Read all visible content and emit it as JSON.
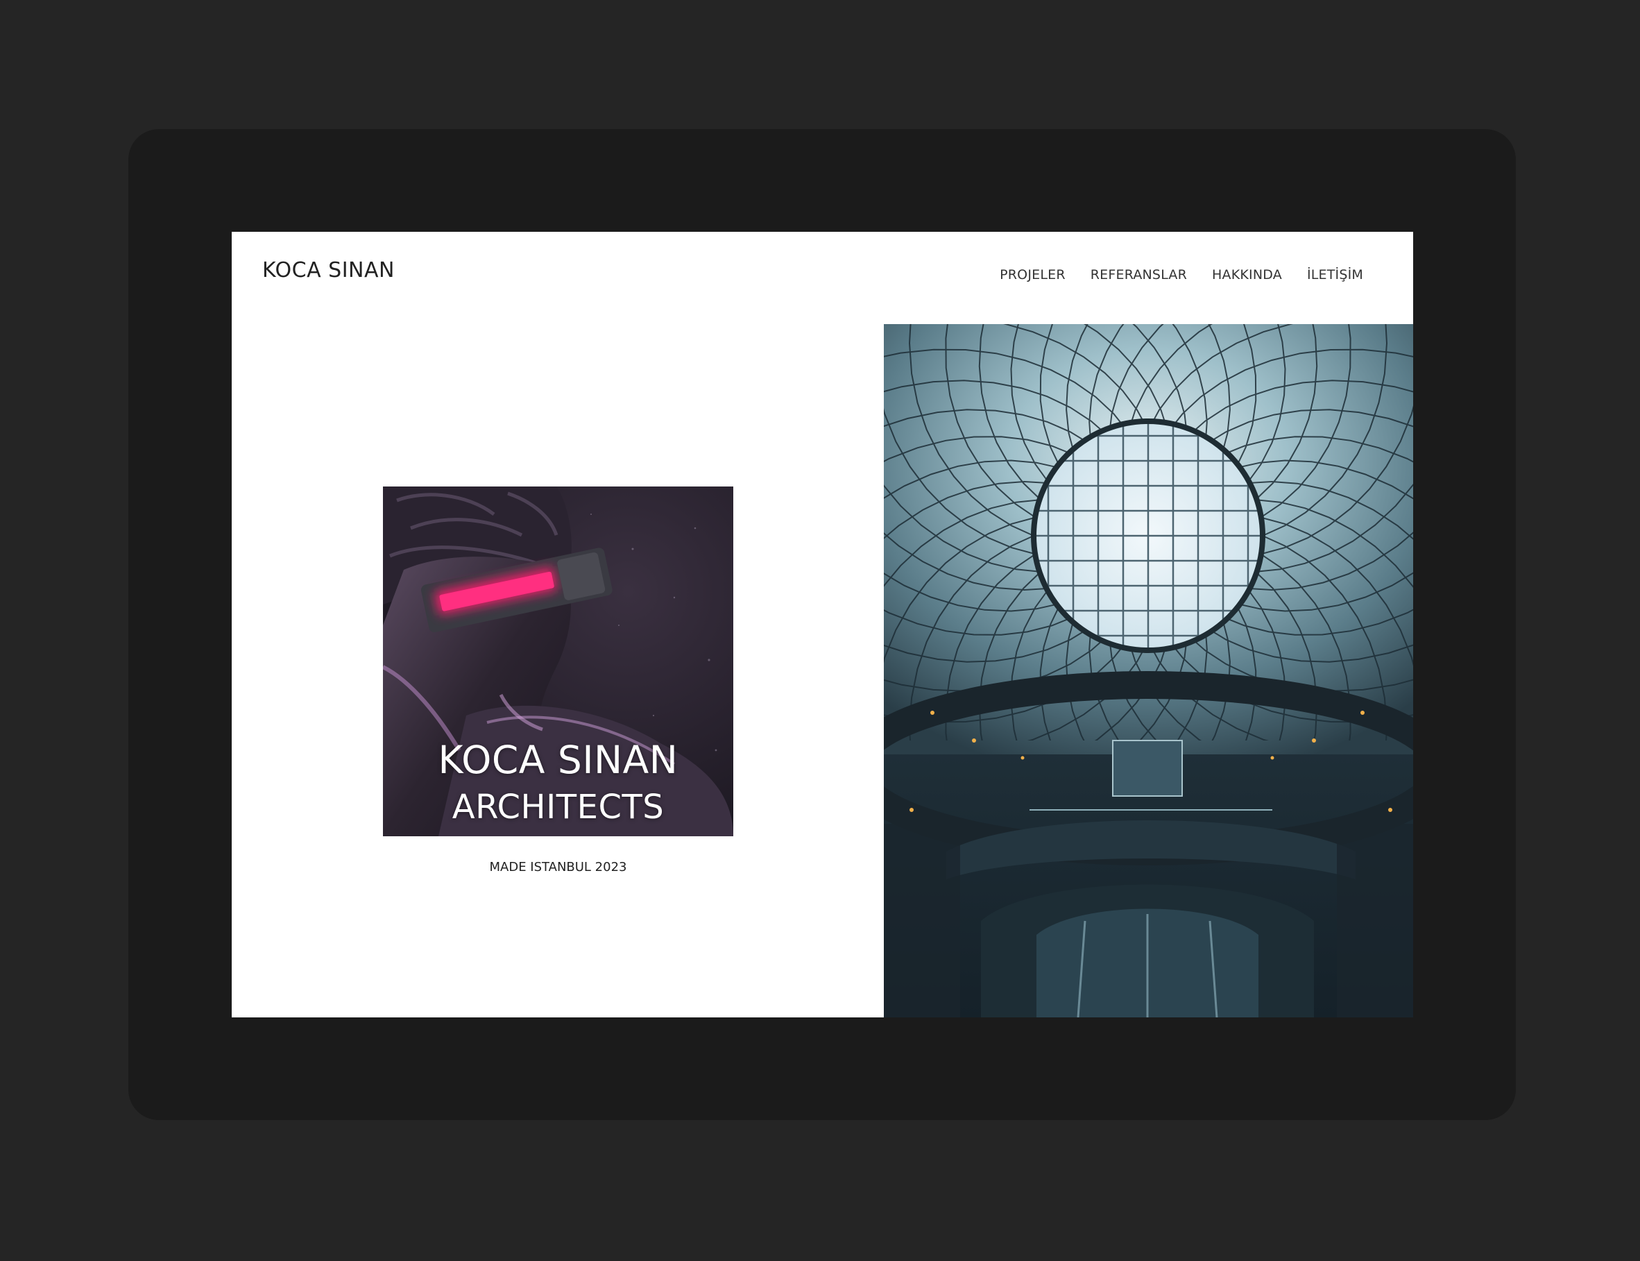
{
  "site": {
    "brand": "KOCA SINAN",
    "nav": [
      {
        "label": "PROJELER"
      },
      {
        "label": "REFERANSLAR"
      },
      {
        "label": "HAKKINDA"
      },
      {
        "label": "İLETİŞİM"
      }
    ]
  },
  "hero": {
    "poster_line1": "KOCA SINAN",
    "poster_line2": "ARCHITECTS",
    "tagline": "MADE ISTANBUL 2023"
  },
  "colors": {
    "outer_background": "#252525",
    "device_frame": "#1b1b1b",
    "screen_background": "#ffffff",
    "visor_accent": "#ff1a6e"
  }
}
